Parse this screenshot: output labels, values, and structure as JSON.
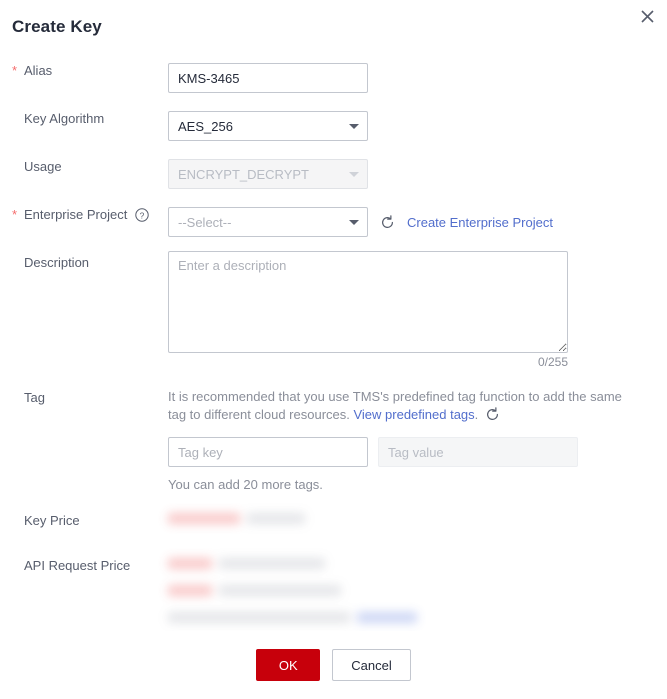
{
  "dialog": {
    "title": "Create Key",
    "close_icon": "close-icon"
  },
  "fields": {
    "alias": {
      "label": "Alias",
      "required_marker": "*",
      "value": "KMS-3465"
    },
    "key_algorithm": {
      "label": "Key Algorithm",
      "value": "AES_256"
    },
    "usage": {
      "label": "Usage",
      "value": "ENCRYPT_DECRYPT",
      "disabled": true
    },
    "enterprise_project": {
      "label": "Enterprise Project",
      "required_marker": "*",
      "help_icon": "help-circle-icon",
      "value": "--Select--",
      "refresh_icon": "refresh-icon",
      "create_link": "Create Enterprise Project"
    },
    "description": {
      "label": "Description",
      "placeholder": "Enter a description",
      "value": "",
      "counter": "0/255"
    },
    "tag": {
      "label": "Tag",
      "hint_part1": "It is recommended that you use TMS's predefined tag function to add the same tag to different cloud resources. ",
      "hint_link": "View predefined tags",
      "hint_part2": ".",
      "refresh_icon": "refresh-icon",
      "key_placeholder": "Tag key",
      "value_placeholder": "Tag value",
      "note": "You can add 20 more tags."
    },
    "key_price": {
      "label": "Key Price",
      "redacted": true
    },
    "api_request_price": {
      "label": "API Request Price",
      "redacted": true
    }
  },
  "footer": {
    "ok_label": "OK",
    "cancel_label": "Cancel"
  },
  "colors": {
    "primary_red": "#c7000b",
    "required_star": "#f56c6c",
    "link_blue": "#526ecc",
    "title_text": "#252b3a",
    "label_text": "#575d6c",
    "placeholder_text": "#adb0b8",
    "border": "#c3c7cf"
  }
}
